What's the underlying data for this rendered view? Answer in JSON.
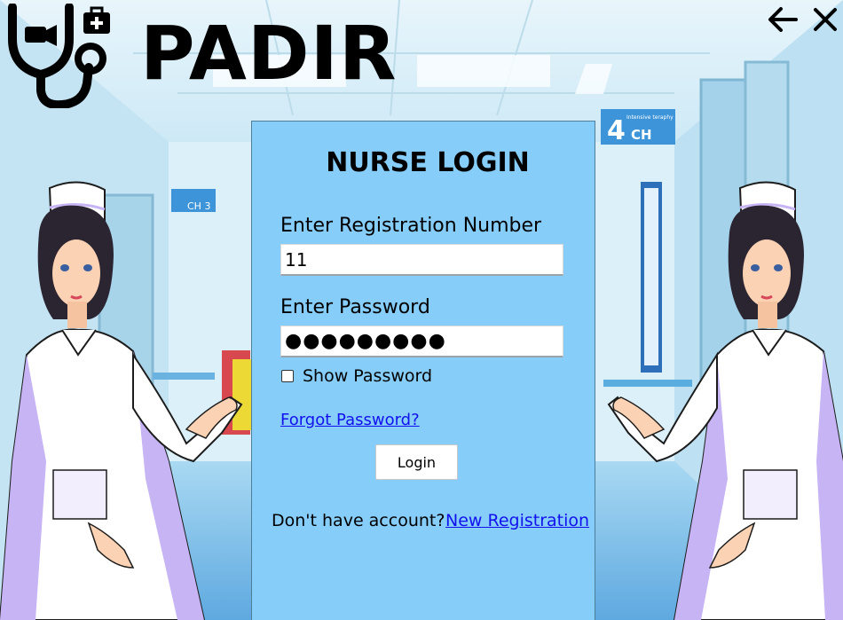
{
  "app": {
    "title": "PADIR"
  },
  "window_controls": {
    "back_icon": "arrow-left-icon",
    "close_icon": "close-icon"
  },
  "background": {
    "sign_left": "CH 3",
    "sign_right_number": "4",
    "sign_right_text": "CH",
    "sign_right_caption": "Intensive teraphy"
  },
  "login": {
    "title": "NURSE LOGIN",
    "registration_label": "Enter Registration Number",
    "registration_value": "11",
    "password_label": "Enter Password",
    "password_mask": "●●●●●●●●●",
    "show_password_label": "Show Password",
    "show_password_checked": false,
    "forgot_password_link": "Forgot Password?",
    "login_button": "Login",
    "no_account_text": "Don't have account?",
    "new_registration_link": "New Registration"
  },
  "colors": {
    "panel": "#87cdf9",
    "link": "#1111ee",
    "uniform": "#ffffff",
    "uniform_shadow": "#c7b4f4"
  }
}
